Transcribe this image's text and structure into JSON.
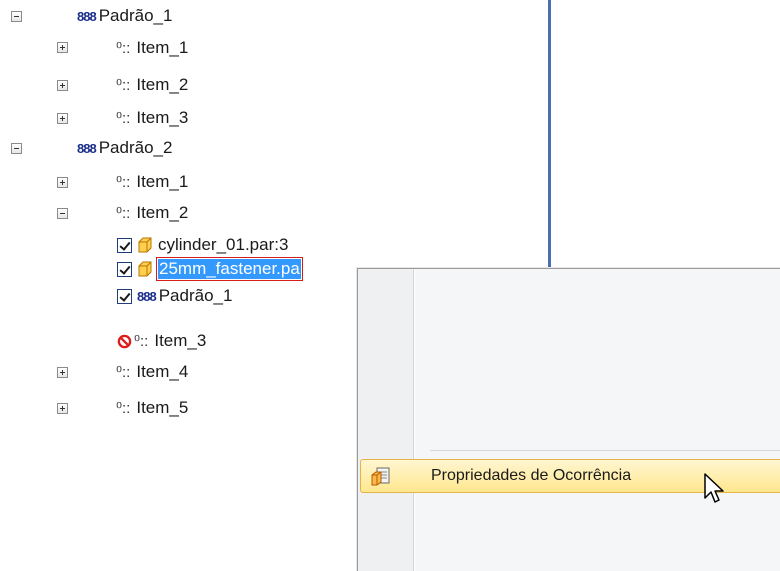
{
  "tree": {
    "rows": [
      {
        "label": "Padrão_1",
        "kind": "pattern",
        "expander": "minus"
      },
      {
        "label": "Item_1",
        "kind": "item",
        "expander": "plus"
      },
      {
        "label": "Item_2",
        "kind": "item",
        "expander": "plus"
      },
      {
        "label": "Item_3",
        "kind": "item",
        "expander": "plus"
      },
      {
        "label": "Padrão_2",
        "kind": "pattern",
        "expander": "minus"
      },
      {
        "label": "Item_1",
        "kind": "item",
        "expander": "plus"
      },
      {
        "label": "Item_2",
        "kind": "item",
        "expander": "minus"
      },
      {
        "label": "cylinder_01.par:3",
        "kind": "part",
        "checked": true
      },
      {
        "label": "25mm_fastener.pa",
        "kind": "part",
        "checked": true,
        "selected": true
      },
      {
        "label": "Padrão_1",
        "kind": "pattern",
        "checked": true
      },
      {
        "label": "Item_3",
        "kind": "item",
        "suppressed": true
      },
      {
        "label": "Item_4",
        "kind": "item",
        "expander": "plus"
      },
      {
        "label": "Item_5",
        "kind": "item",
        "expander": "plus"
      }
    ]
  },
  "icons": {
    "pattern": "pattern-icon",
    "item": "pattern-item-icon",
    "part": "part-cube-icon",
    "suppressed": "no-entry-icon",
    "occurrence_properties": "occurrence-properties-icon"
  },
  "glyphs": {
    "pattern": "888",
    "item": "⁰::"
  },
  "context_menu": {
    "item_label": "Propriedades de Ocorrência"
  },
  "colors": {
    "selection": "#3399ff",
    "selection_border": "#d81c1c",
    "menu_highlight": "#ffe78e",
    "divider": "#4a6fb0"
  }
}
